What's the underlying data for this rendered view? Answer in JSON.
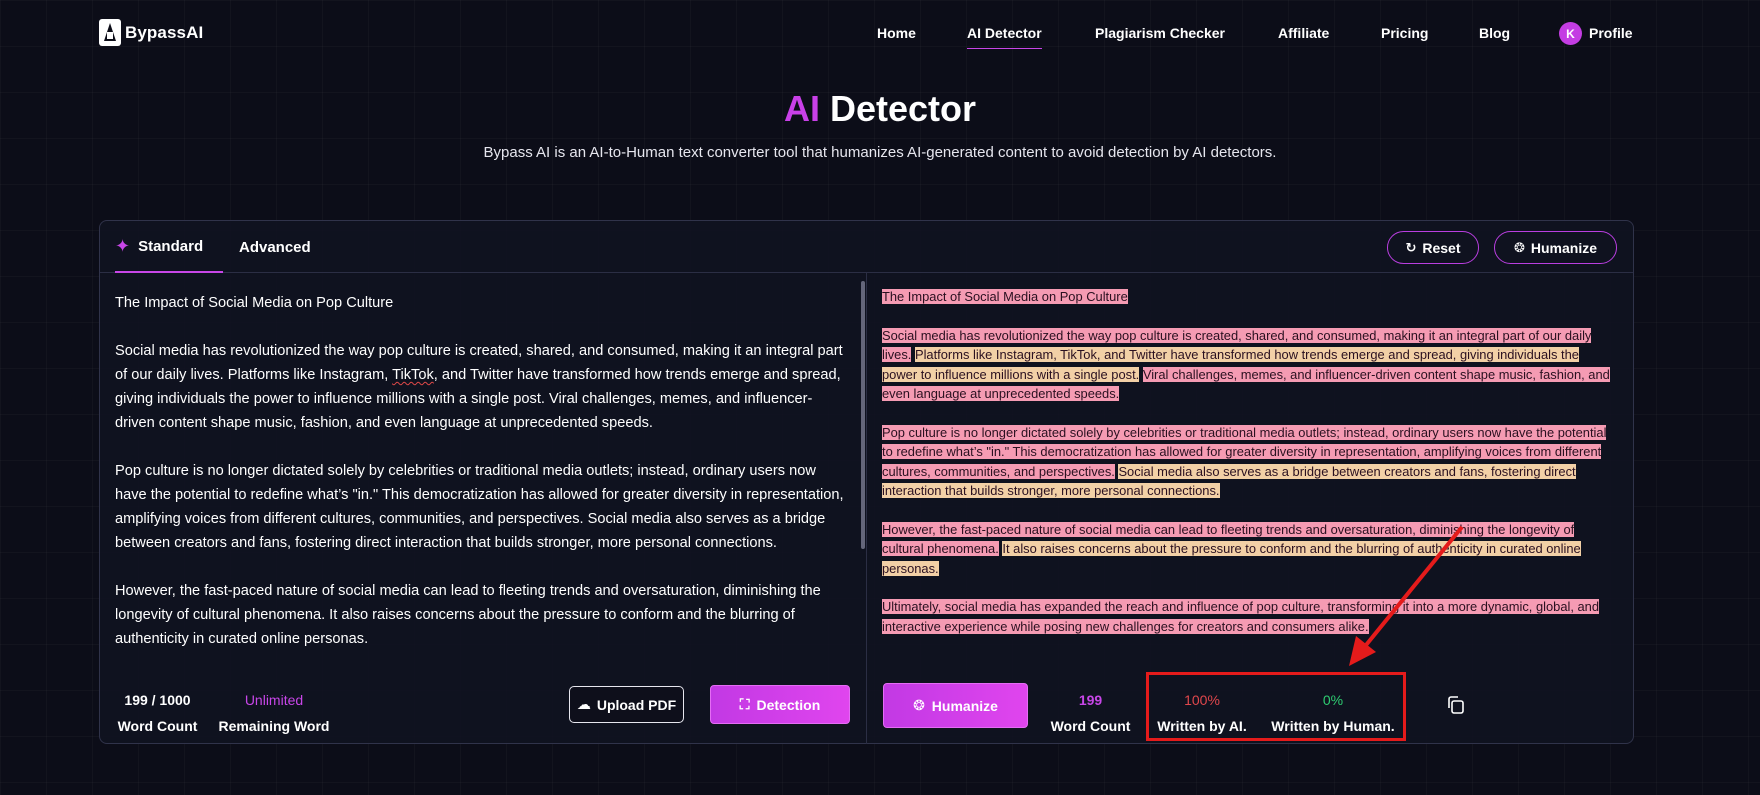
{
  "brand": {
    "name": "BypassAI"
  },
  "nav": {
    "links": [
      "Home",
      "AI Detector",
      "Plagiarism Checker",
      "Affiliate",
      "Pricing",
      "Blog"
    ],
    "active": "AI Detector",
    "profile_initial": "K",
    "profile_label": "Profile"
  },
  "hero": {
    "title_accent": "AI",
    "title_rest": "Detector",
    "subtitle": "Bypass AI is an AI-to-Human text converter tool that humanizes AI-generated content to avoid detection by AI detectors."
  },
  "tabs": {
    "standard": "Standard",
    "advanced": "Advanced"
  },
  "actions": {
    "reset": "Reset",
    "humanize_top": "Humanize"
  },
  "input_text": {
    "title": "The Impact of Social Media on Pop Culture",
    "p1": "Social media has revolutionized the way pop culture is created, shared, and consumed, making it an integral part of our daily lives. Platforms like Instagram, ",
    "p1_flag": "TikTok",
    "p1_tail": ", and Twitter have transformed how trends emerge and spread, giving individuals the power to influence millions with a single post. Viral challenges, memes, and influencer-driven content shape music, fashion, and even language at unprecedented speeds.",
    "p2": "Pop culture is no longer dictated solely by celebrities or traditional media outlets; instead, ordinary users now have the potential to redefine what’s \"in.\" This democratization has allowed for greater diversity in representation, amplifying voices from different cultures, communities, and perspectives. Social media also serves as a bridge between creators and fans, fostering direct interaction that builds stronger, more personal connections.",
    "p3": "However, the fast-paced nature of social media can lead to fleeting trends and oversaturation, diminishing the longevity of cultural phenomena. It also raises concerns about the pressure to conform and the blurring of authenticity in curated online personas."
  },
  "result_text": {
    "title": "The Impact of Social Media on Pop Culture",
    "p1a": "Social media has revolutionized the way pop culture is created, shared, and consumed, making it an integral part of our daily lives.",
    "p1b": "Platforms like Instagram, TikTok, and Twitter have transformed how trends emerge and spread, giving individuals the power to influence millions with a single post.",
    "p1c": "Viral challenges, memes, and influencer-driven content shape music, fashion, and even language at unprecedented speeds.",
    "p2a": "Pop culture is no longer dictated solely by celebrities or traditional media outlets; instead, ordinary users now have the potential to redefine what’s \"in.\" This democratization has allowed for greater diversity in representation, amplifying voices from different cultures, communities, and perspectives.",
    "p2b": "Social media also serves as a bridge between creators and fans, fostering direct interaction that builds stronger, more personal connections.",
    "p3a": "However, the fast-paced nature of social media can lead to fleeting trends and oversaturation, diminishing the longevity of cultural phenomena.",
    "p3b": "It also raises concerns about the pressure to conform and the blurring of authenticity in curated online personas.",
    "p4": "Ultimately, social media has expanded the reach and influence of pop culture, transforming it into a more dynamic, global, and interactive experience while posing new challenges for creators and consumers alike."
  },
  "left_stats": {
    "word_count_value": "199 / 1000",
    "word_count_label": "Word Count",
    "remaining_value": "Unlimited",
    "remaining_label": "Remaining Word"
  },
  "left_buttons": {
    "upload": "Upload PDF",
    "detect": "Detection"
  },
  "right_buttons": {
    "humanize": "Humanize"
  },
  "right_stats": {
    "word_count_value": "199",
    "word_count_label": "Word Count",
    "ai_value": "100%",
    "ai_label": "Written by AI.",
    "human_value": "0%",
    "human_label": "Written by Human."
  },
  "colors": {
    "accent": "#c846e8",
    "ai_highlight": "#f59bb3",
    "ai_alt_highlight": "#f2d0a6",
    "ai_stat": "#e0474c",
    "human_stat": "#2ecc71",
    "annotation": "#e51b1b"
  }
}
